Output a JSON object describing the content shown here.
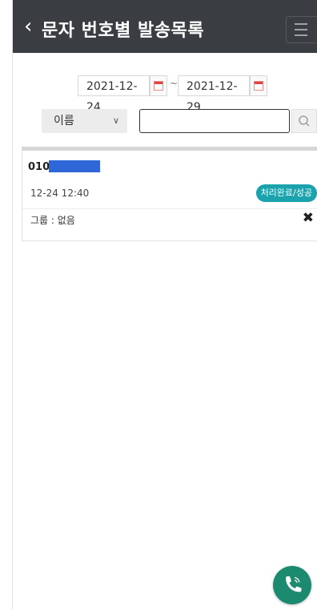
{
  "header": {
    "back_icon": "chevron-left-icon",
    "title": "문자 번호별 발송목록",
    "menu_icon": "hamburger-menu-icon"
  },
  "date_range": {
    "start": "2021-12-24",
    "separator": "~",
    "end": "2021-12-29",
    "calendar_icon": "calendar-icon"
  },
  "search": {
    "field_selected": "이름",
    "dropdown_icon": "chevron-down-icon",
    "query": "",
    "search_icon": "magnifier-icon"
  },
  "records": [
    {
      "phone_prefix": "010-",
      "phone_masked": true,
      "datetime": "12-24 12:40",
      "status": "처리완료/성공",
      "group": "그룹 : 없음",
      "delete_icon": "close-x-icon"
    }
  ],
  "fab": {
    "icon": "phone-call-icon"
  },
  "colors": {
    "header_bg": "#3a3e42",
    "badge": "#1aa3ad",
    "fab": "#1b8a6f",
    "mask": "#2f67d8"
  }
}
